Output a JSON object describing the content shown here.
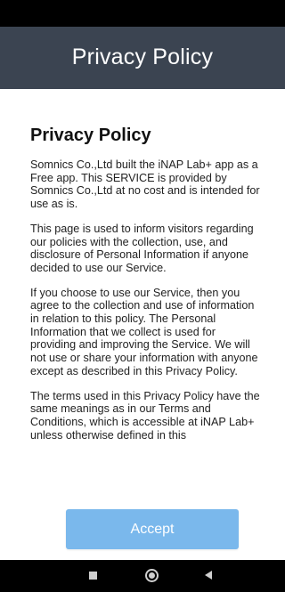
{
  "app_bar": {
    "title": "Privacy Policy"
  },
  "document": {
    "heading": "Privacy Policy",
    "paragraphs": [
      "Somnics Co.,Ltd built the iNAP Lab+ app as a Free app. This SERVICE is provided by Somnics Co.,Ltd at no cost and is intended for use as is.",
      "This page is used to inform visitors regarding our policies with the collection, use, and disclosure of Personal Information if anyone decided to use our Service.",
      "If you choose to use our Service, then you agree to the collection and use of information in relation to this policy. The Personal Information that we collect is used for providing and improving the Service. We will not use or share your information with anyone except as described in this Privacy Policy.",
      "The terms used in this Privacy Policy have the same meanings as in our Terms and Conditions, which is accessible at iNAP Lab+ unless otherwise defined in this"
    ]
  },
  "footer": {
    "accept_label": "Accept"
  },
  "icons": {
    "recents": "square-recents-icon",
    "home": "circle-home-icon",
    "back": "triangle-back-icon"
  },
  "colors": {
    "app_bar": "#3b4451",
    "accept_button": "#7ab8ec",
    "system_bars": "#000000"
  }
}
